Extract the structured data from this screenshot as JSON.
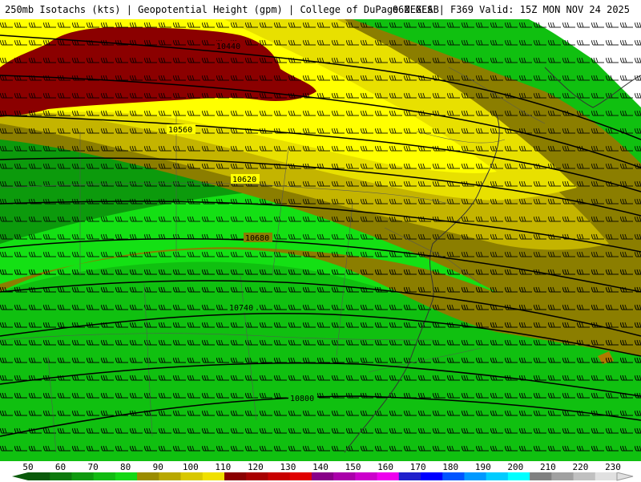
{
  "header": {
    "title_left": "250mb Isotachs (kts) | Geopotential Height (gpm) | College of DuPage NEXLAB",
    "title_right": "06Z GFS | F369 Valid: 15Z MON NOV 24 2025"
  },
  "contour_labels": [
    "10440",
    "10560",
    "10620",
    "10680",
    "10740",
    "10800"
  ],
  "colorbar": {
    "labels": [
      "50",
      "60",
      "70",
      "80",
      "90",
      "100",
      "110",
      "120",
      "130",
      "140",
      "150",
      "160",
      "170",
      "180",
      "190",
      "200",
      "210",
      "220",
      "230"
    ],
    "colors": [
      "#0b5a0b",
      "#0e7a0e",
      "#0f9a0f",
      "#12bb12",
      "#14d814",
      "#9a8c00",
      "#b8a800",
      "#d8c800",
      "#f0e000",
      "#8a0000",
      "#a80000",
      "#c80000",
      "#e00000",
      "#880088",
      "#aa00aa",
      "#cc00cc",
      "#ee00ee",
      "#2020cc",
      "#0000ff",
      "#0055ff",
      "#0099ff",
      "#00ccff",
      "#00ffff",
      "#808080",
      "#a0a0a0",
      "#c0c0c0",
      "#e0e0e0"
    ]
  },
  "fill_colors": {
    "dark_green": "#0c9a0c",
    "mid_green": "#10c010",
    "bright_green": "#14e014",
    "olive": "#8b7e00",
    "dark_yellow": "#c4b400",
    "yellow": "#e8e000",
    "bright_yellow": "#ffff00",
    "maroon": "#8b0000",
    "white": "#ffffff"
  }
}
